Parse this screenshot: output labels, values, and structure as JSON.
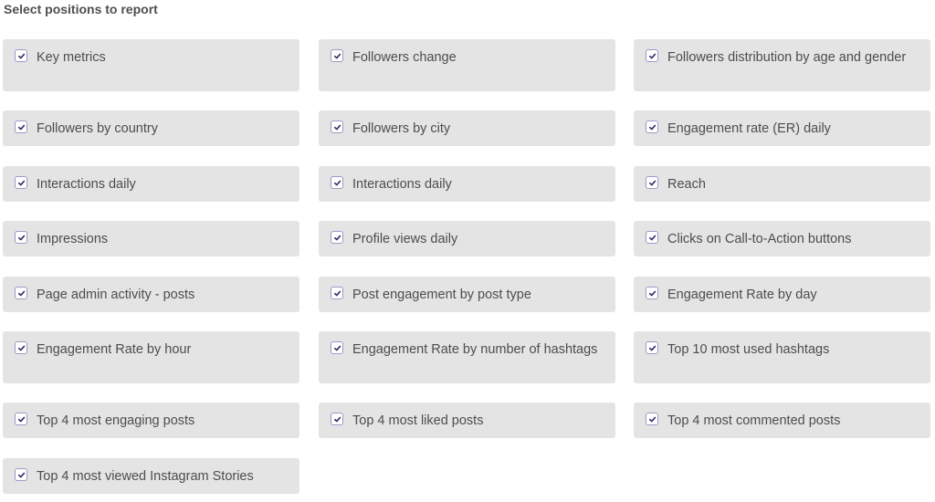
{
  "title": "Select positions to report",
  "accent_color": "#2e2a6b",
  "items": [
    {
      "label": "Key metrics",
      "checked": true
    },
    {
      "label": "Followers change",
      "checked": true
    },
    {
      "label": "Followers distribution by age and gender",
      "checked": true
    },
    {
      "label": "Followers by country",
      "checked": true
    },
    {
      "label": "Followers by city",
      "checked": true
    },
    {
      "label": "Engagement rate (ER) daily",
      "checked": true
    },
    {
      "label": "Interactions daily",
      "checked": true
    },
    {
      "label": "Interactions daily",
      "checked": true
    },
    {
      "label": "Reach",
      "checked": true
    },
    {
      "label": "Impressions",
      "checked": true
    },
    {
      "label": "Profile views daily",
      "checked": true
    },
    {
      "label": "Clicks on Call-to-Action buttons",
      "checked": true
    },
    {
      "label": "Page admin activity - posts",
      "checked": true
    },
    {
      "label": "Post engagement by post type",
      "checked": true
    },
    {
      "label": "Engagement Rate by day",
      "checked": true
    },
    {
      "label": "Engagement Rate by hour",
      "checked": true
    },
    {
      "label": "Engagement Rate by number of hashtags",
      "checked": true
    },
    {
      "label": "Top 10 most used hashtags",
      "checked": true
    },
    {
      "label": "Top 4 most engaging posts",
      "checked": true
    },
    {
      "label": "Top 4 most liked posts",
      "checked": true
    },
    {
      "label": "Top 4 most commented posts",
      "checked": true
    },
    {
      "label": "Top 4 most viewed Instagram Stories",
      "checked": true
    }
  ]
}
